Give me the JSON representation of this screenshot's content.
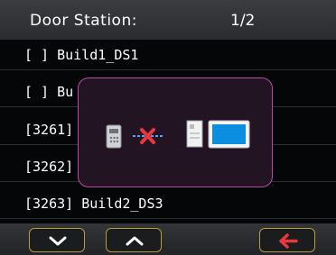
{
  "header": {
    "title": "Door Station:",
    "page": "1/2"
  },
  "list": [
    {
      "label": "[ ] Build1_DS1"
    },
    {
      "label": "[ ] Bu"
    },
    {
      "label": "[3261]"
    },
    {
      "label": "[3262]"
    },
    {
      "label": "[3263] Build2_DS3"
    }
  ],
  "popup": {
    "icons": [
      "door-station-icon",
      "connection-failed-icon",
      "indoor-monitor-icon",
      "display-screen-icon"
    ],
    "colors": {
      "fail": "#e8383d",
      "link": "#4aa8ff",
      "screen": "#0b8de0",
      "border": "#b94aa3"
    }
  },
  "footer": {
    "icons": [
      "chevron-down-icon",
      "chevron-up-icon",
      "back-arrow-icon"
    ],
    "colors": {
      "border": "#b99a3c",
      "back": "#e8383d"
    }
  }
}
